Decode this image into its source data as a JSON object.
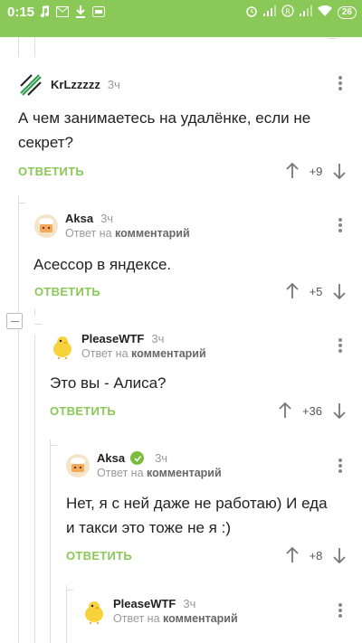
{
  "statusbar": {
    "time": "0:15",
    "battery": "26"
  },
  "comments": [
    {
      "author": "KrLzzzzz",
      "time": "3ч",
      "text_line1": "А чем занимаетесь на удалёнке, если не",
      "text_line2": "секрет?",
      "reply_label": "ОТВЕТИТЬ",
      "score": "+9"
    },
    {
      "author": "Aksa",
      "time": "3ч",
      "reply_prefix": "Ответ на",
      "reply_target": "комментарий",
      "text_line1": "Асессор в яндексе.",
      "reply_label": "ОТВЕТИТЬ",
      "score": "+5"
    },
    {
      "author": "PleaseWTF",
      "time": "3ч",
      "reply_prefix": "Ответ на",
      "reply_target": "комментарий",
      "text_line1": "Это вы - Алиса?",
      "reply_label": "ОТВЕТИТЬ",
      "score": "+36"
    },
    {
      "author": "Aksa",
      "time": "3ч",
      "reply_prefix": "Ответ на",
      "reply_target": "комментарий",
      "text_line1": "Нет, я с ней даже не работаю) И еда",
      "text_line2": "и такси это тоже не я :)",
      "reply_label": "ОТВЕТИТЬ",
      "score": "+8"
    },
    {
      "author": "PleaseWTF",
      "time": "3ч",
      "reply_prefix": "Ответ на",
      "reply_target": "комментарий"
    }
  ],
  "colors": {
    "accent": "#8ac858",
    "text": "#222222",
    "muted": "#999999"
  }
}
